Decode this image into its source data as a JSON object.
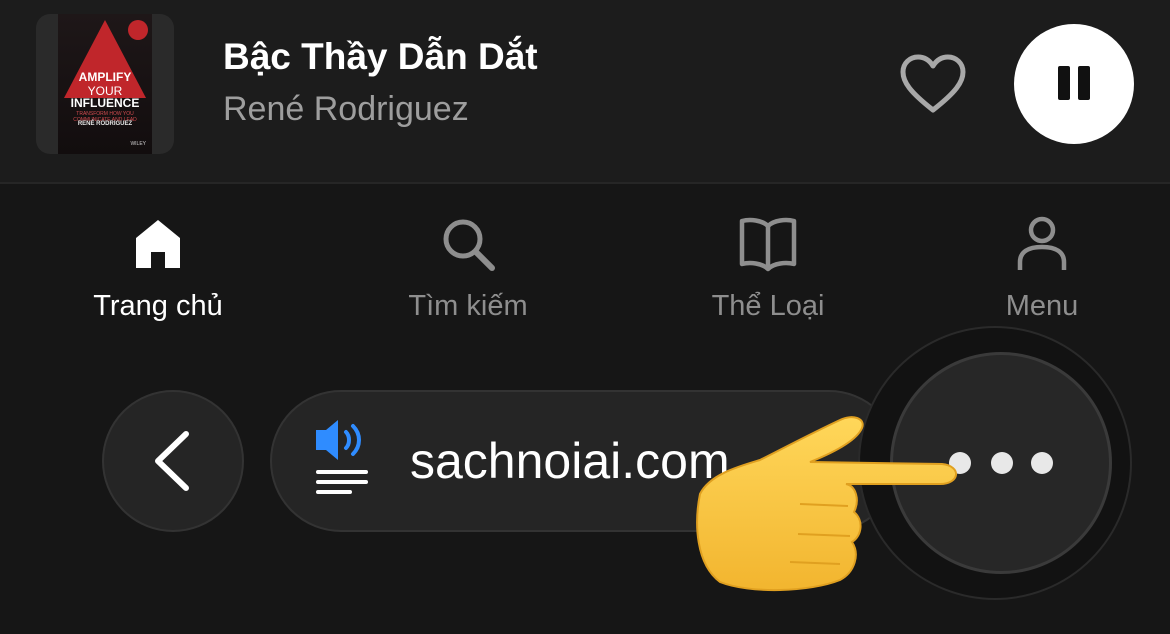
{
  "now_playing": {
    "title": "Bậc Thầy Dẫn Dắt",
    "author": "René Rodriguez",
    "cover": {
      "line1": "AMPLIFY",
      "line2": "YOUR",
      "line3": "INFLUENCE",
      "tagline": "TRANSFORM HOW YOU COMMUNICATE AND LEAD",
      "author": "RENÉ RODRIGUEZ",
      "publisher": "WILEY"
    },
    "icons": {
      "favorite": "heart-outline-icon",
      "playback": "pause-icon"
    }
  },
  "bottom_nav": {
    "items": [
      {
        "label": "Trang chủ",
        "icon": "home-icon",
        "active": true
      },
      {
        "label": "Tìm kiếm",
        "icon": "search-icon",
        "active": false
      },
      {
        "label": "Thể Loại",
        "icon": "book-icon",
        "active": false
      },
      {
        "label": "Menu",
        "icon": "user-icon",
        "active": false
      }
    ]
  },
  "browser_bar": {
    "url": "sachnoiai.com",
    "icons": {
      "back": "chevron-left-icon",
      "reader": "speaker-icon",
      "more": "more-dots-icon"
    }
  },
  "overlay": {
    "icon": "pointing-hand-emoji"
  },
  "colors": {
    "background": "#161616",
    "bar_background": "#1c1c1c",
    "speaker_accent": "#2f8cff",
    "active_label": "#ffffff",
    "inactive_label": "#8e8e8e"
  }
}
